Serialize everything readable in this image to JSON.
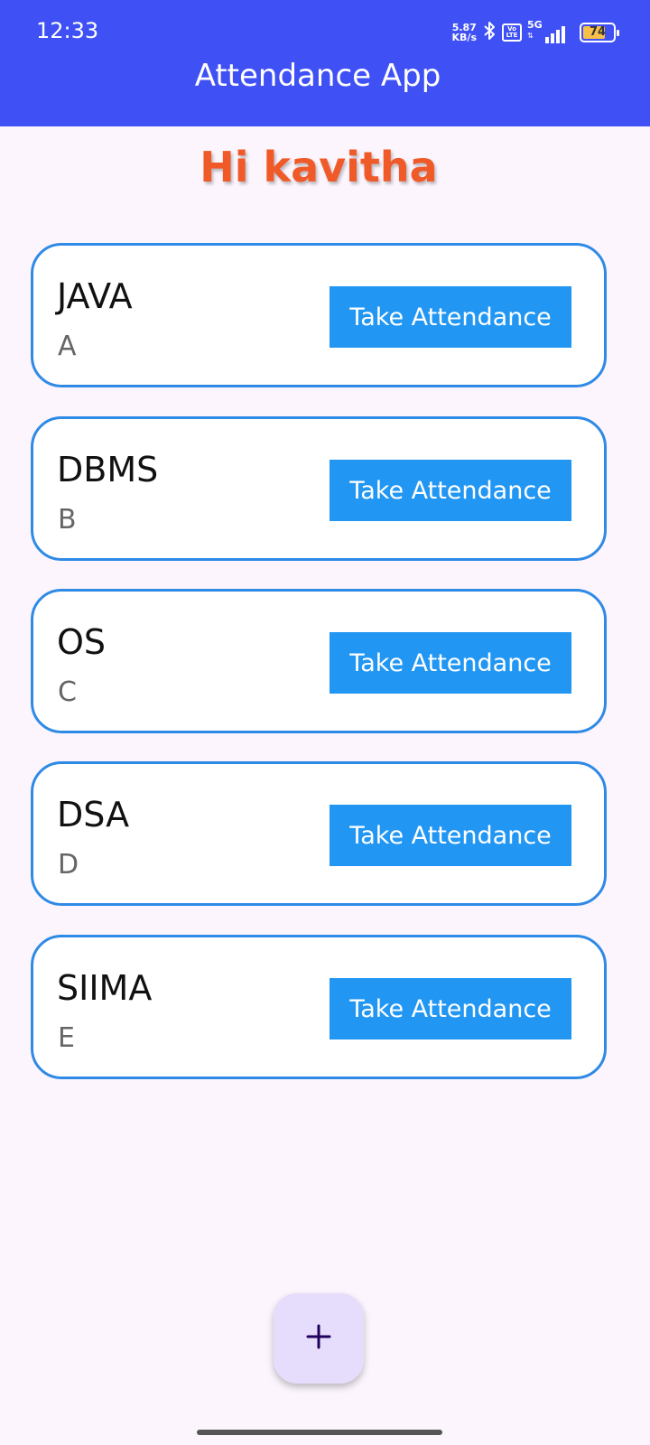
{
  "status_bar": {
    "time": "12:33",
    "net_speed_value": "5.87",
    "net_speed_unit": "KB/s",
    "volte_top": "Vo",
    "volte_bottom": "LTE",
    "network_type": "5G",
    "battery_level": "74",
    "battery_fraction": 0.74
  },
  "header": {
    "title": "Attendance App"
  },
  "greeting": "Hi kavitha",
  "courses": [
    {
      "name": "JAVA",
      "section": "A",
      "button_label": "Take Attendance"
    },
    {
      "name": "DBMS",
      "section": "B",
      "button_label": "Take Attendance"
    },
    {
      "name": "OS",
      "section": "C",
      "button_label": "Take Attendance"
    },
    {
      "name": "DSA",
      "section": "D",
      "button_label": "Take Attendance"
    },
    {
      "name": "SIIMA",
      "section": "E",
      "button_label": "Take Attendance"
    }
  ],
  "fab": {
    "icon": "plus-icon"
  },
  "colors": {
    "app_bar": "#3f51f5",
    "greeting": "#f05a28",
    "card_border": "#2f8ae6",
    "button": "#2196f3",
    "fab": "#e6dcfc"
  }
}
